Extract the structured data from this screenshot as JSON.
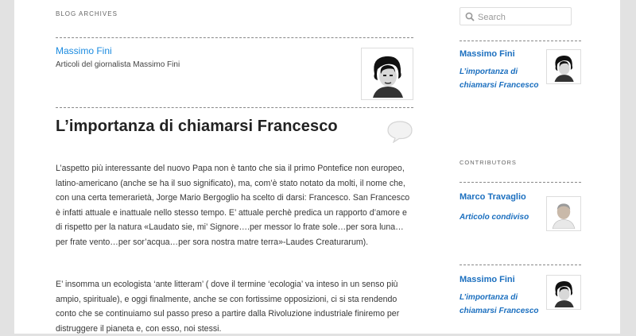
{
  "archive": {
    "label": "BLOG ARCHIVES"
  },
  "author": {
    "name": "Massimo Fini",
    "description": "Articoli del giornalista Massimo Fini"
  },
  "post": {
    "title": "L’importanza di chiamarsi Francesco",
    "paragraphs": [
      "L’aspetto più interessante del nuovo Papa non è tanto che sia il primo Pontefice non europeo, latino-americano (anche se ha il suo significato), ma, com’è stato notato da molti, il nome che, con una certa temerarietà, Jorge Mario Bergoglio ha scelto di darsi: Francesco. San Francesco è infatti attuale e inattuale nello stesso tempo. E’ attuale perchè predica un rapporto d’amore e di rispetto per la natura «Laudato sie, mi’ Signore….per messor lo frate sole…per sora luna…per frate vento…per sor’acqua…per sora nostra matre terra»-Laudes Creaturarum).",
      "E’ insomma un ecologista ‘ante litteram’ ( dove il termine ‘ecologia’ va inteso in un senso più ampio, spirituale), e oggi finalmente, anche se con fortissime opposizioni, ci si sta rendendo conto che se continuiamo sul passo preso a partire dalla Rivoluzione industriale finiremo per distruggere il pianeta e, con esso, noi stessi."
    ]
  },
  "sidebar": {
    "search_placeholder": "Search",
    "entries_top": [
      {
        "name": "Massimo Fini",
        "subtitle": "L’importanza di chiamarsi Francesco"
      }
    ],
    "contributors_label": "CONTRIBUTORS",
    "entries": [
      {
        "name": "Marco Travaglio",
        "subtitle": "Articolo condiviso"
      },
      {
        "name": "Massimo Fini",
        "subtitle": "L’importanza di chiamarsi Francesco"
      }
    ]
  }
}
